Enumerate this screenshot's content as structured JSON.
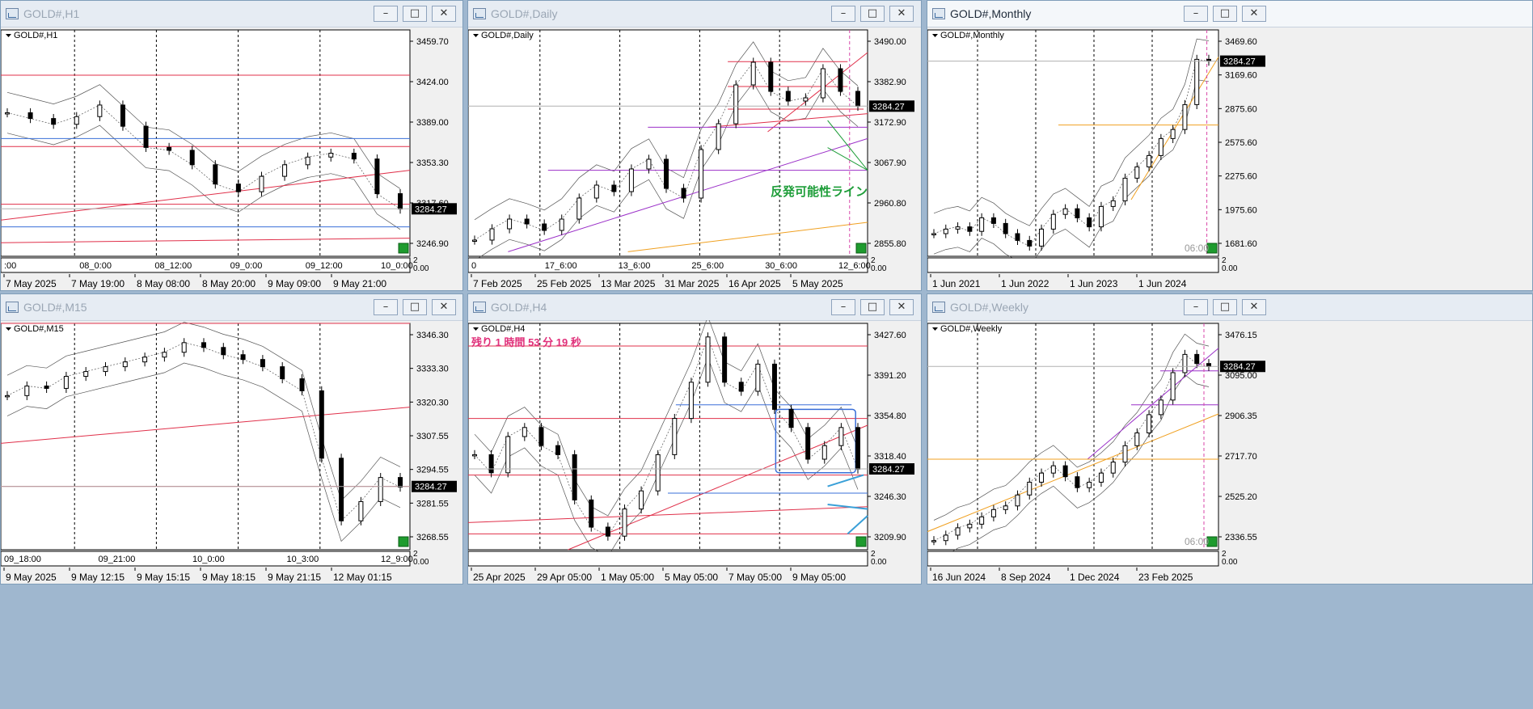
{
  "charts": [
    {
      "id": "h1",
      "window_title": "GOLD#,H1",
      "active": false,
      "header_label": "GOLD#,H1",
      "price_labels": [
        "3459.70",
        "3424.00",
        "3389.00",
        "3353.30",
        "3317.60",
        "3246.90"
      ],
      "current_price": "3284.27",
      "scale_marker": "2",
      "scale_zero": "0.00",
      "date_labels": [
        "7 May 2025",
        "7 May 19:00",
        "8 May 08:00",
        "8 May 20:00",
        "9 May 09:00",
        "9 May 21:00"
      ],
      "mini_labels": [
        ":00",
        "08_0:00",
        "08_12:00",
        "09_0:00",
        "09_12:00",
        "10_0:00"
      ],
      "annotation": ""
    },
    {
      "id": "daily",
      "window_title": "GOLD#,Daily",
      "active": false,
      "header_label": "GOLD#,Daily",
      "price_labels": [
        "3490.00",
        "3382.90",
        "3172.90",
        "3067.90",
        "2960.80",
        "2855.80"
      ],
      "current_price": "3284.27",
      "scale_marker": "2",
      "scale_zero": "0.00",
      "date_labels": [
        "7 Feb 2025",
        "25 Feb 2025",
        "13 Mar 2025",
        "31 Mar 2025",
        "16 Apr 2025",
        "5 May 2025"
      ],
      "mini_labels": [
        "0",
        "17_6:00",
        "13_6:00",
        "25_6:00",
        "30_6:00",
        "12_6:00"
      ],
      "annotation": "反発可能性ライン"
    },
    {
      "id": "monthly",
      "window_title": "GOLD#,Monthly",
      "active": true,
      "header_label": "GOLD#,Monthly",
      "price_labels": [
        "3469.60",
        "3169.60",
        "2875.60",
        "2575.60",
        "2275.60",
        "1975.60",
        "1681.60"
      ],
      "current_price": "3284.27",
      "scale_marker": "2",
      "scale_zero": "0.00",
      "date_labels": [
        "1 Jun 2021",
        "1 Jun 2022",
        "1 Jun 2023",
        "1 Jun 2024"
      ],
      "mini_labels": [],
      "time_tag": "06:00",
      "annotation": ""
    },
    {
      "id": "m15",
      "window_title": "GOLD#,M15",
      "active": false,
      "header_label": "GOLD#,M15",
      "price_labels": [
        "3346.30",
        "3333.30",
        "3320.30",
        "3307.55",
        "3294.55",
        "3281.55",
        "3268.55"
      ],
      "current_price": "3284.27",
      "scale_marker": "2",
      "scale_zero": "0.00",
      "date_labels": [
        "9 May 2025",
        "9 May 12:15",
        "9 May 15:15",
        "9 May 18:15",
        "9 May 21:15",
        "12 May 01:15"
      ],
      "mini_labels": [
        "09_18:00",
        "09_21:00",
        "10_0:00",
        "10_3:00",
        "12_9:00"
      ],
      "annotation": ""
    },
    {
      "id": "h4",
      "window_title": "GOLD#,H4",
      "active": false,
      "header_label": "GOLD#,H4",
      "price_labels": [
        "3427.60",
        "3391.20",
        "3354.80",
        "3318.40",
        "3246.30",
        "3209.90"
      ],
      "current_price": "3284.27",
      "scale_marker": "2",
      "scale_zero": "0.00",
      "date_labels": [
        "25 Apr 2025",
        "29 Apr 05:00",
        "1 May 05:00",
        "5 May 05:00",
        "7 May 05:00",
        "9 May 05:00"
      ],
      "mini_labels": [],
      "annotation": "残り 1 時間 53 分 19 秒"
    },
    {
      "id": "weekly",
      "window_title": "GOLD#,Weekly",
      "active": false,
      "header_label": "GOLD#,Weekly",
      "price_labels": [
        "3476.15",
        "3095.00",
        "2906.35",
        "2717.70",
        "2525.20",
        "2336.55"
      ],
      "current_price": "3284.27",
      "scale_marker": "2",
      "scale_zero": "0.00",
      "date_labels": [
        "16 Jun 2024",
        "8 Sep 2024",
        "1 Dec 2024",
        "23 Feb 2025"
      ],
      "mini_labels": [],
      "time_tag": "06:00",
      "annotation": ""
    }
  ],
  "chart_data": [
    {
      "type": "candlestick",
      "title": "GOLD#,H1",
      "x": [
        "7 May 2025",
        "7 May 19:00",
        "8 May 08:00",
        "8 May 20:00",
        "9 May 09:00",
        "9 May 21:00"
      ],
      "close_path": [
        3384,
        3378,
        3372,
        3380,
        3392,
        3370,
        3348,
        3345,
        3330,
        3310,
        3302,
        3318,
        3330,
        3338,
        3342,
        3336,
        3300,
        3284
      ],
      "ylim": [
        3235,
        3470
      ],
      "last_price": 3284.27
    },
    {
      "type": "candlestick",
      "title": "GOLD#,Daily",
      "x": [
        "7 Feb 2025",
        "25 Feb 2025",
        "13 Mar 2025",
        "31 Mar 2025",
        "16 Apr 2025",
        "5 May 2025"
      ],
      "close_path": [
        2870,
        2905,
        2935,
        2920,
        2900,
        2935,
        3000,
        3040,
        3020,
        3090,
        3120,
        3030,
        3000,
        3150,
        3230,
        3350,
        3420,
        3330,
        3300,
        3310,
        3400,
        3330,
        3284
      ],
      "ylim": [
        2820,
        3520
      ],
      "last_price": 3284.27
    },
    {
      "type": "candlestick",
      "title": "GOLD#,Monthly",
      "x": [
        "1 Jun 2021",
        "1 Jun 2022",
        "1 Jun 2023",
        "1 Jun 2024"
      ],
      "close_path": [
        1760,
        1800,
        1820,
        1780,
        1900,
        1850,
        1760,
        1700,
        1650,
        1800,
        1930,
        1980,
        1900,
        1820,
        2000,
        2050,
        2250,
        2350,
        2450,
        2600,
        2680,
        2900,
        3300,
        3284
      ],
      "ylim": [
        1560,
        3560
      ],
      "last_price": 3284.27
    },
    {
      "type": "candlestick",
      "title": "GOLD#,M15",
      "x": [
        "9 May 2025",
        "9 May 12:15",
        "9 May 15:15",
        "9 May 18:15",
        "9 May 21:15",
        "12 May 01:15"
      ],
      "close_path": [
        3322,
        3326,
        3325,
        3330,
        3332,
        3334,
        3336,
        3338,
        3340,
        3344,
        3342,
        3339,
        3337,
        3334,
        3329,
        3324,
        3296,
        3270,
        3278,
        3288,
        3284
      ],
      "ylim": [
        3258,
        3352
      ],
      "last_price": 3284.27
    },
    {
      "type": "candlestick",
      "title": "GOLD#,H4",
      "x": [
        "25 Apr 2025",
        "29 Apr 05:00",
        "1 May 05:00",
        "5 May 05:00",
        "7 May 05:00",
        "9 May 05:00"
      ],
      "close_path": [
        3300,
        3280,
        3320,
        3330,
        3310,
        3300,
        3250,
        3220,
        3210,
        3240,
        3260,
        3300,
        3340,
        3380,
        3430,
        3380,
        3370,
        3400,
        3350,
        3330,
        3295,
        3310,
        3330,
        3284
      ],
      "ylim": [
        3195,
        3445
      ],
      "last_price": 3284.27
    },
    {
      "type": "candlestick",
      "title": "GOLD#,Weekly",
      "x": [
        "16 Jun 2024",
        "8 Sep 2024",
        "1 Dec 2024",
        "23 Feb 2025"
      ],
      "close_path": [
        2330,
        2360,
        2400,
        2420,
        2460,
        2500,
        2520,
        2580,
        2650,
        2700,
        2740,
        2680,
        2620,
        2650,
        2700,
        2760,
        2850,
        2920,
        3020,
        3100,
        3250,
        3350,
        3300,
        3284
      ],
      "ylim": [
        2280,
        3520
      ],
      "last_price": 3284.27
    }
  ]
}
